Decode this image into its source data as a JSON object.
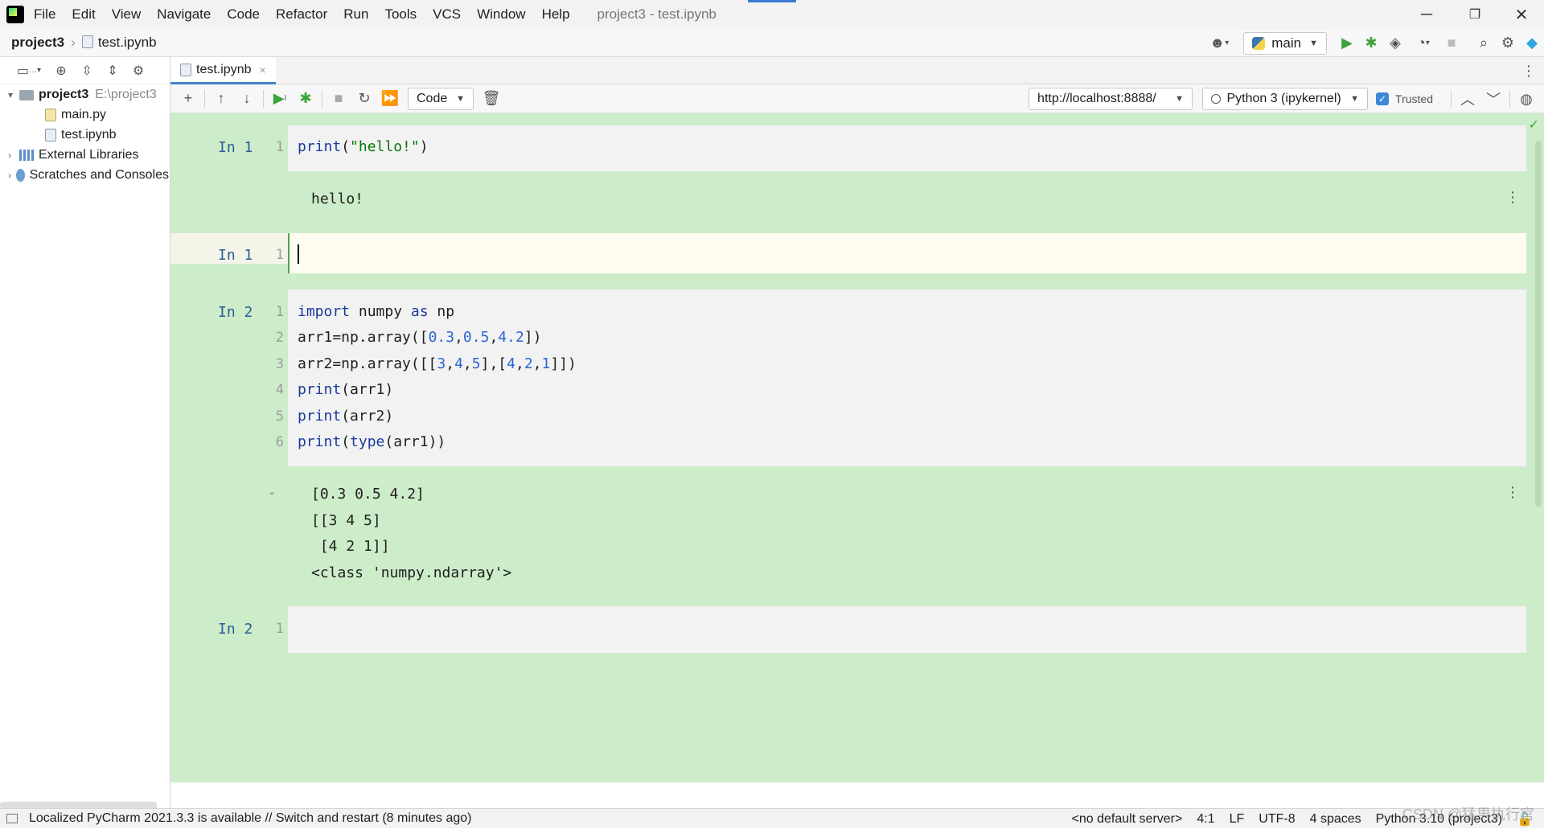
{
  "window": {
    "title": "project3 - test.ipynb",
    "menu": [
      "File",
      "Edit",
      "View",
      "Navigate",
      "Code",
      "Refactor",
      "Run",
      "Tools",
      "VCS",
      "Window",
      "Help"
    ],
    "controls": {
      "minimize": "─",
      "restore": "❐",
      "close": "✕"
    }
  },
  "navbar": {
    "project": "project3",
    "file": "test.ipynb",
    "run_config": "main"
  },
  "project_panel": {
    "root_name": "project3",
    "root_path": "E:\\project3",
    "files": [
      "main.py",
      "test.ipynb"
    ],
    "external_libraries": "External Libraries",
    "scratches": "Scratches and Consoles"
  },
  "editor_tab": {
    "label": "test.ipynb",
    "close": "×"
  },
  "notebook_toolbar": {
    "cell_type": "Code",
    "server_url": "http://localhost:8888/",
    "kernel": "Python 3 (ipykernel)",
    "trusted_label": "Trusted"
  },
  "cells": [
    {
      "prompt": "In 1",
      "lines": [
        {
          "n": "1",
          "text": "print(\"hello!\")"
        }
      ],
      "output": [
        "hello!"
      ]
    },
    {
      "prompt": "In 1",
      "lines": [
        {
          "n": "1",
          "text": ""
        }
      ],
      "output": []
    },
    {
      "prompt": "In 2",
      "lines": [
        {
          "n": "1",
          "text": "import numpy as np"
        },
        {
          "n": "2",
          "text": "arr1=np.array([0.3,0.5,4.2])"
        },
        {
          "n": "3",
          "text": "arr2=np.array([[3,4,5],[4,2,1]])"
        },
        {
          "n": "4",
          "text": "print(arr1)"
        },
        {
          "n": "5",
          "text": "print(arr2)"
        },
        {
          "n": "6",
          "text": "print(type(arr1))"
        }
      ],
      "output": [
        "[0.3 0.5 4.2]",
        "[[3 4 5]",
        " [4 2 1]]",
        "<class 'numpy.ndarray'>"
      ]
    },
    {
      "prompt": "In 2",
      "lines": [
        {
          "n": "1",
          "text": ""
        }
      ],
      "output": []
    }
  ],
  "statusbar": {
    "message": "Localized PyCharm 2021.3.3 is available // Switch and restart (8 minutes ago)",
    "server": "<no default server>",
    "position": "4:1",
    "line_sep": "LF",
    "encoding": "UTF-8",
    "indent": "4 spaces",
    "interpreter": "Python 3.10 (project3)"
  },
  "watermark": "CSDN @猛男执行官",
  "icons": [
    "app-logo-icon",
    "user-icon",
    "python-icon",
    "run-icon",
    "debug-icon",
    "coverage-icon",
    "profile-icon",
    "stop-icon",
    "search-icon",
    "gear-icon",
    "toolbox-icon",
    "locate-icon",
    "expand-icon",
    "collapse-icon",
    "add-cell-icon",
    "move-up-icon",
    "move-down-icon",
    "run-cell-icon",
    "debug-cell-icon",
    "interrupt-icon",
    "restart-icon",
    "run-all-icon",
    "delete-icon",
    "globe-icon"
  ],
  "colors": {
    "notebook_bg": "#cdecc9",
    "code_cell_bg": "#f2f2f2",
    "active_cell_bg": "#fefcf0",
    "prompt": "#2a5f99",
    "accent": "#4083c9"
  }
}
